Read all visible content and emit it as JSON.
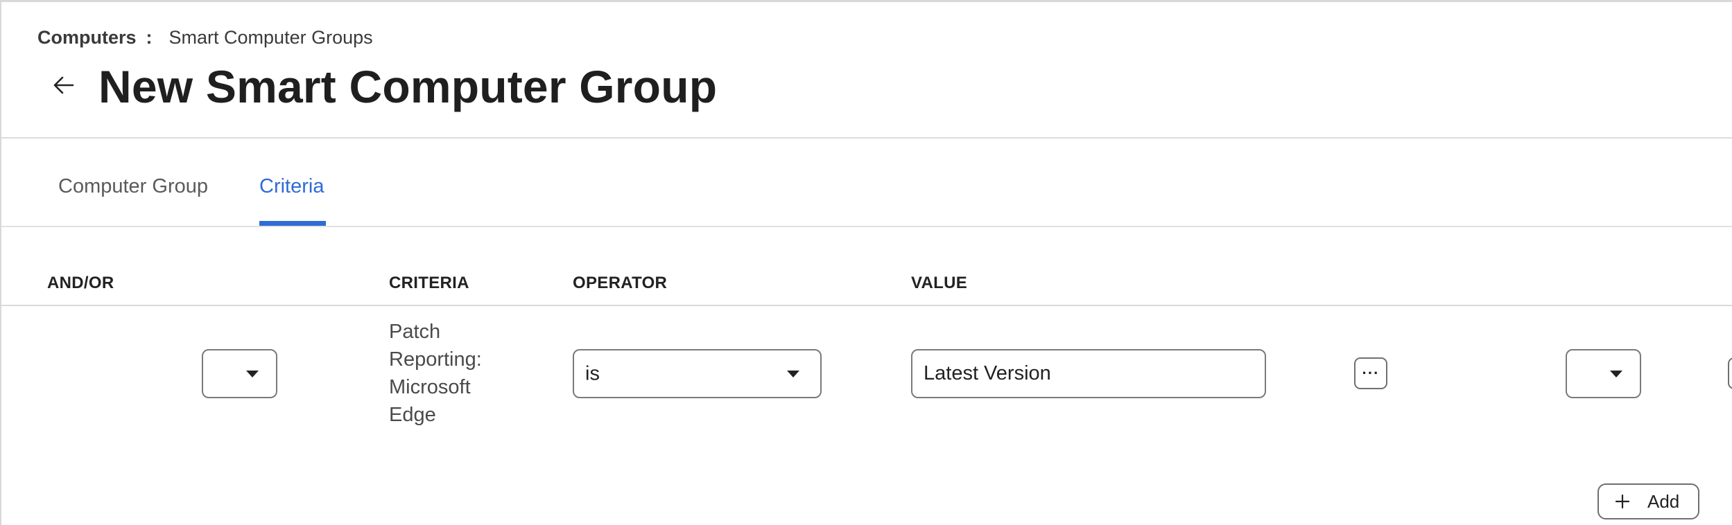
{
  "breadcrumb": {
    "root": "Computers",
    "separator": ":",
    "current": "Smart Computer Groups"
  },
  "page": {
    "title": "New Smart Computer Group"
  },
  "tabs": [
    {
      "label": "Computer Group",
      "active": false
    },
    {
      "label": "Criteria",
      "active": true
    }
  ],
  "table": {
    "headers": {
      "and_or": "AND/OR",
      "criteria": "CRITERIA",
      "operator": "OPERATOR",
      "value": "VALUE"
    },
    "rows": [
      {
        "and_or": "",
        "criteria_lines": [
          "Patch",
          "Reporting:",
          "Microsoft",
          "Edge"
        ],
        "operator": "is",
        "value": "Latest Version",
        "more_label": "···",
        "trailing_select": ""
      }
    ]
  },
  "actions": {
    "add_label": "Add"
  },
  "icons": {
    "back": "arrow-left-icon",
    "more": "ellipsis-icon",
    "add": "plus-icon",
    "dropdown": "caret-down-icon"
  },
  "colors": {
    "accent": "#2f6bd6",
    "text": "#1f1f1f",
    "border": "#7a7a7a"
  }
}
